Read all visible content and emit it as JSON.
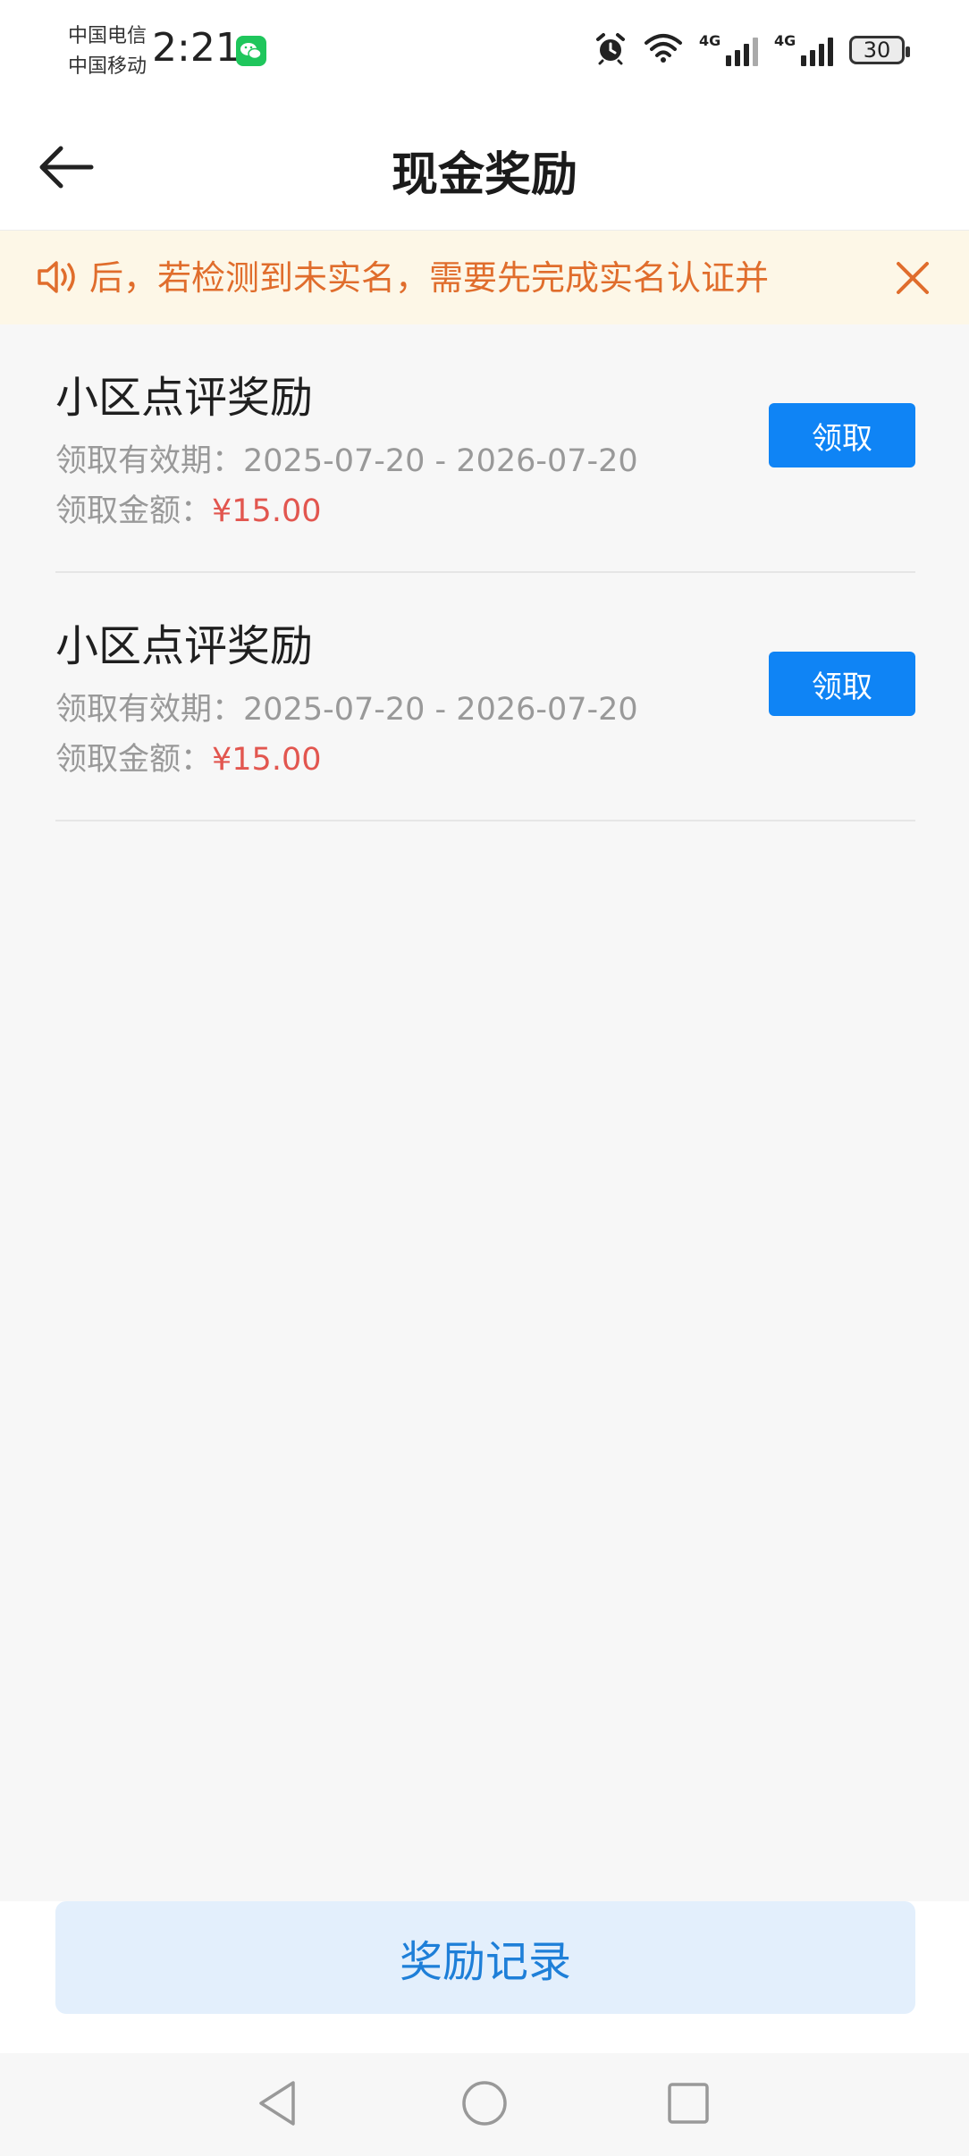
{
  "status_bar": {
    "carrier1": "中国电信",
    "carrier2": "中国移动",
    "time": "2:21",
    "signal1_label": "4G",
    "signal2_label": "4G",
    "battery": "30",
    "icons": [
      "wechat-icon",
      "alarm-icon",
      "wifi-icon",
      "signal-icon",
      "signal-icon",
      "battery-icon"
    ]
  },
  "header": {
    "title": "现金奖励",
    "back_icon": "arrow-left-icon"
  },
  "notice": {
    "text": "后，若检测到未实名，需要先完成实名认证并",
    "speaker_icon": "speaker-icon",
    "close_icon": "close-icon",
    "color": "#e06d2c",
    "background": "#fdf7e7"
  },
  "rewards": [
    {
      "title": "小区点评奖励",
      "period_label": "领取有效期：",
      "period": "2025-07-20 - 2026-07-20",
      "amount_label": "领取金额：",
      "amount": "¥15.00",
      "button": "领取"
    },
    {
      "title": "小区点评奖励",
      "period_label": "领取有效期：",
      "period": "2025-07-20 - 2026-07-20",
      "amount_label": "领取金额：",
      "amount": "¥15.00",
      "button": "领取"
    }
  ],
  "footer": {
    "records_button": "奖励记录"
  },
  "system_nav": {
    "icons": [
      "nav-back-icon",
      "nav-home-icon",
      "nav-recents-icon"
    ]
  },
  "colors": {
    "accent": "#0f84f5",
    "amount": "#e2564f",
    "records_button_bg": "#e3effc",
    "records_button_text": "#1e7fd8"
  }
}
